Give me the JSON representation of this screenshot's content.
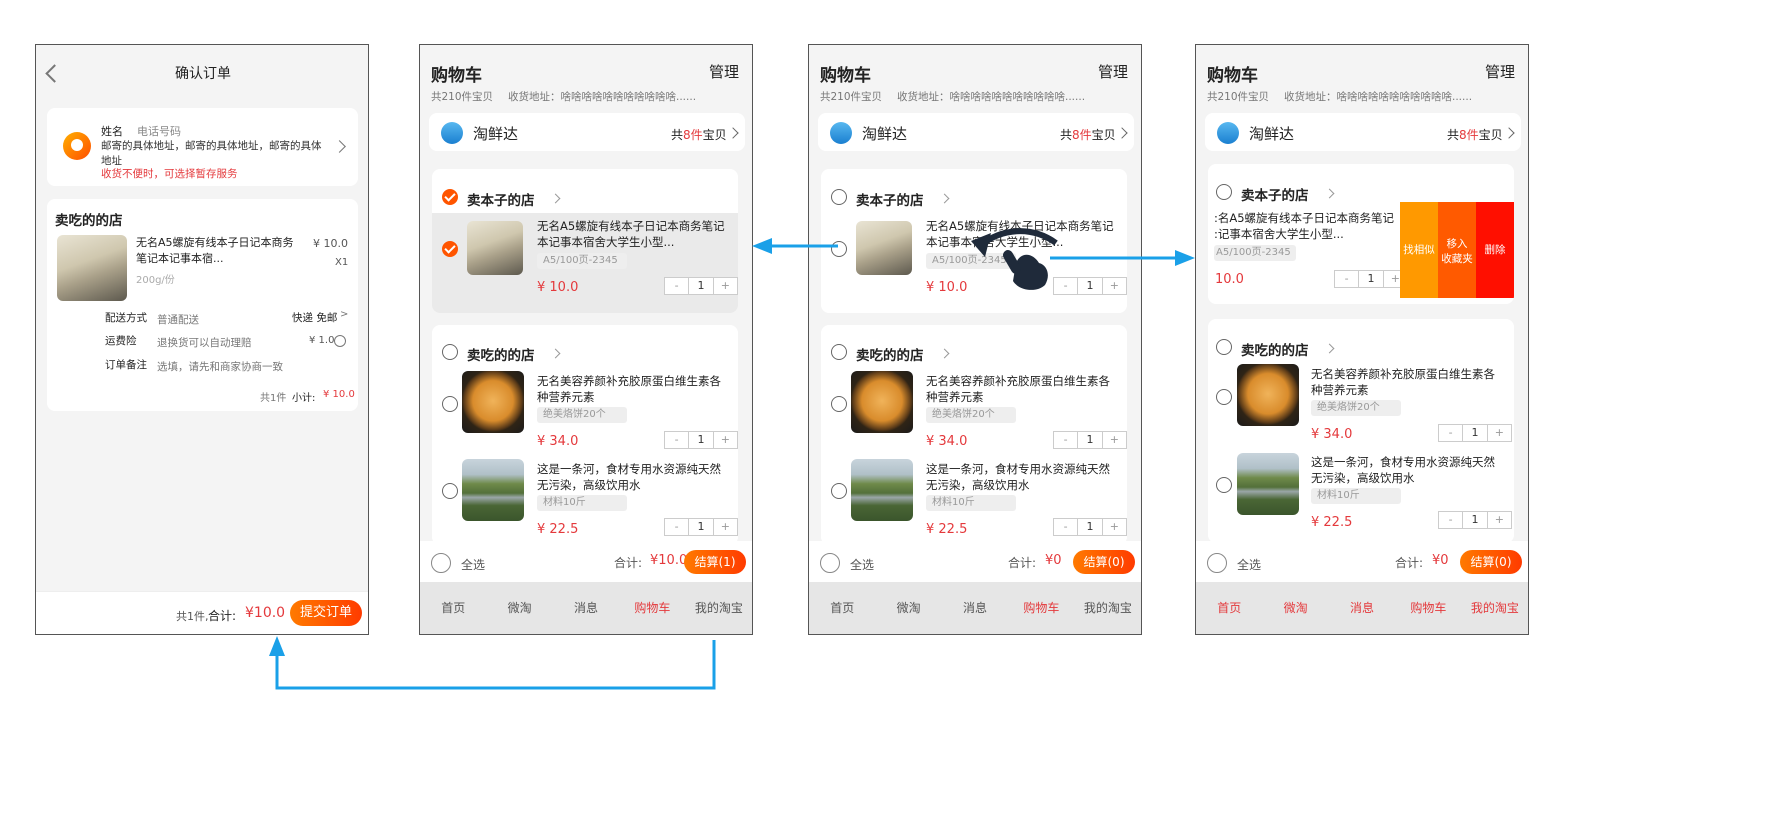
{
  "colors": {
    "accent": "#ff5500",
    "price": "#e4393c",
    "arrow": "#1aa0e8",
    "tab_active": "#e4393c"
  },
  "confirm": {
    "title": "确认订单",
    "name": "姓名",
    "phone": "电话号码",
    "address": "邮寄的具体地址，邮寄的具体地址，邮寄的具体地址",
    "notice": "收货不便时，可选择暂存服务",
    "shop": "卖吃的的店",
    "product": "无名A5螺旋有线本子日记本商务笔记本记事本宿...",
    "price": "¥ 10.0",
    "qty": "X1",
    "weight": "200g/份",
    "delivery_label": "配送方式",
    "delivery_value": "普通配送",
    "delivery_right": "快递 免邮",
    "insure_label": "运费险",
    "insure_value": "退换货可以自动理赔",
    "insure_price": "¥ 1.0",
    "remark_label": "订单备注",
    "remark_value": "选填，请先和商家协商一致",
    "subtotal_count": "共1件",
    "subtotal_label": "小计:",
    "subtotal_value": "¥ 10.0",
    "footer_count": "共1件,",
    "footer_total_label": "合计:",
    "footer_total": "¥10.0",
    "submit": "提交订单"
  },
  "cart": {
    "title": "购物车",
    "manage": "管理",
    "count": "共210件宝贝",
    "address": "收货地址：啥啥啥啥啥啥啥啥啥啥啥......",
    "store": "淘鲜达",
    "store_count_pre": "共",
    "store_count_num": "8件",
    "store_count_post": "宝贝",
    "shop1": "卖本子的店",
    "shop2": "卖吃的的店",
    "item1_name1": "无名A5螺旋有线本子日记本商务笔记",
    "item1_name2": "本记事本宿舍大学生小型...",
    "item1_spec": "A5/100页-2345",
    "item1_price": "¥ 10.0",
    "item2_name1": "无名美容养颜补充胶原蛋白维生素各",
    "item2_name2": "种营养元素",
    "item2_spec": "绝美烙饼20个",
    "item2_price": "¥ 34.0",
    "item3_name1": "这是一条河，食材专用水资源纯天然",
    "item3_name2": "无污染，高级饮用水",
    "item3_spec": "材料10斤",
    "item3_price": "¥ 22.5",
    "qty": "1",
    "minus": "-",
    "plus": "+",
    "select_all": "全选",
    "total_label": "合计:",
    "total_2": "¥10.0",
    "checkout_2": "结算(1)",
    "total_3": "¥0",
    "checkout_3": "结算(0)",
    "total_4": "¥0",
    "checkout_4": "结算(0)",
    "swipe_name1": ":名A5螺旋有线本子日记本商务笔记",
    "swipe_name2": ":记事本宿舍大学生小型...",
    "swipe_spec": "A5/100页-2345",
    "swipe_price": "10.0",
    "act_similar": "找相似",
    "act_fav1": "移入",
    "act_fav2": "收藏夹",
    "act_delete": "删除",
    "tabs": [
      "首页",
      "微淘",
      "消息",
      "购物车",
      "我的淘宝"
    ]
  }
}
